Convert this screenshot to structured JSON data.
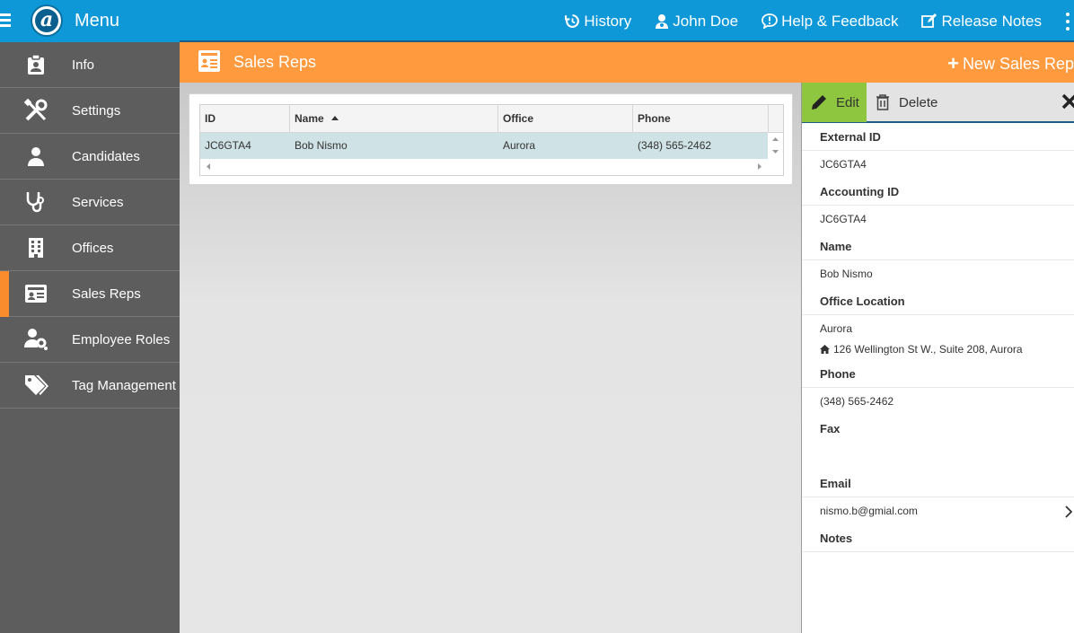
{
  "topbar": {
    "menu_title": "Menu",
    "logo_letter": "a",
    "nav": [
      {
        "label": "History",
        "icon": "history-icon"
      },
      {
        "label": "John Doe",
        "icon": "user-icon"
      },
      {
        "label": "Help & Feedback",
        "icon": "help-icon"
      },
      {
        "label": "Release Notes",
        "icon": "edit-icon"
      }
    ]
  },
  "sidebar": {
    "items": [
      {
        "label": "Info",
        "icon": "badge-icon"
      },
      {
        "label": "Settings",
        "icon": "tools-icon"
      },
      {
        "label": "Candidates",
        "icon": "person-icon"
      },
      {
        "label": "Services",
        "icon": "stethoscope-icon"
      },
      {
        "label": "Offices",
        "icon": "building-icon"
      },
      {
        "label": "Sales Reps",
        "icon": "id-card-icon",
        "active": true
      },
      {
        "label": "Employee Roles",
        "icon": "user-gears-icon"
      },
      {
        "label": "Tag Management",
        "icon": "tags-icon"
      }
    ]
  },
  "page": {
    "title": "Sales Reps",
    "new_button": "New Sales Rep"
  },
  "grid": {
    "columns": [
      "ID",
      "Name",
      "Office",
      "Phone"
    ],
    "sorted_column": "Name",
    "rows": [
      {
        "id": "JC6GTA4",
        "name": "Bob Nismo",
        "office": "Aurora",
        "phone": "(348) 565-2462"
      }
    ]
  },
  "detail": {
    "edit_label": "Edit",
    "delete_label": "Delete",
    "fields": {
      "external_id_label": "External ID",
      "external_id": "JC6GTA4",
      "accounting_id_label": "Accounting ID",
      "accounting_id": "JC6GTA4",
      "name_label": "Name",
      "name": "Bob Nismo",
      "office_label": "Office Location",
      "office": "Aurora",
      "office_address": "126 Wellington St W., Suite 208, Aurora",
      "phone_label": "Phone",
      "phone": "(348) 565-2462",
      "fax_label": "Fax",
      "fax": "",
      "email_label": "Email",
      "email": "nismo.b@gmial.com",
      "notes_label": "Notes"
    }
  },
  "colors": {
    "topbar": "#0f98d8",
    "sidebar": "#5d5d5d",
    "accent_orange": "#ff9a3e",
    "edit_green": "#8ec63f",
    "selected_row": "#cfe2e5"
  }
}
